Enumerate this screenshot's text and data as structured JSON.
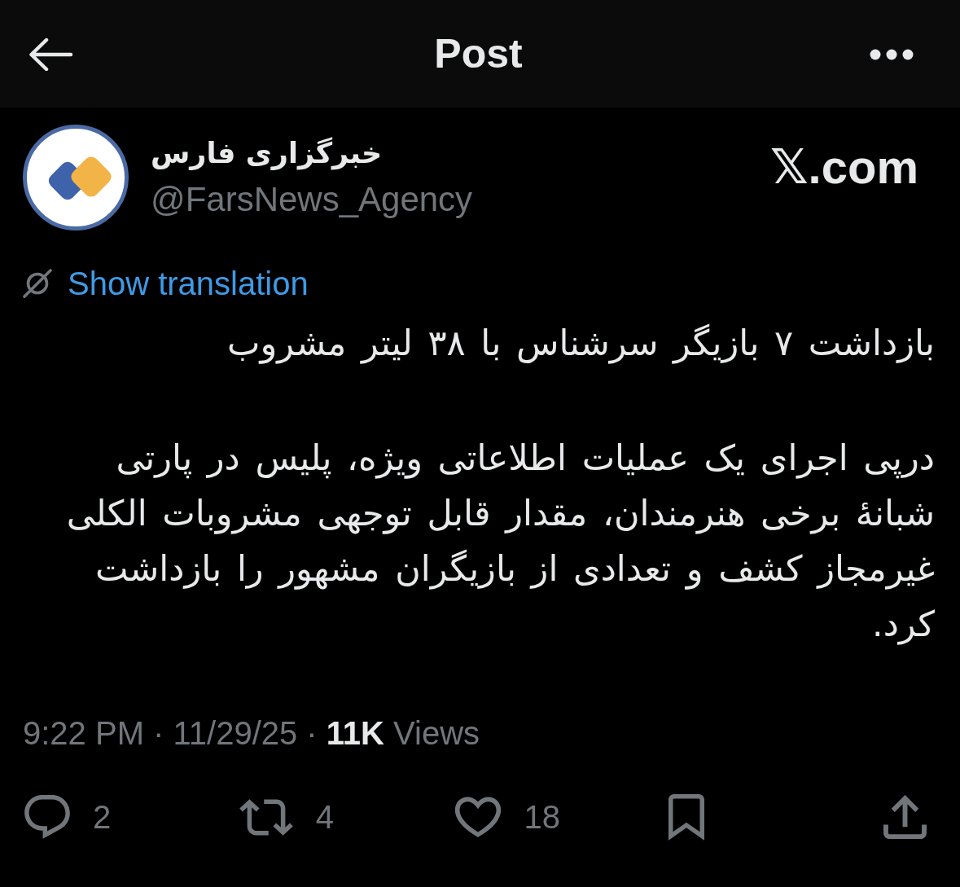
{
  "header": {
    "title": "Post"
  },
  "author": {
    "name": "خبرگزاری فارس",
    "handle": "@FarsNews_Agency"
  },
  "source_label": "𝕏.com",
  "translation": {
    "label": "Show translation"
  },
  "post": {
    "paragraphs": [
      "بازداشت ۷ بازیگر سرشناس با ۳۸ لیتر مشروب",
      "درپی اجرای یک عملیات اطلاعاتی ویژه، پلیس در پارتی شبانهٔ برخی هنرمندان، مقدار قابل توجهی مشروبات الکلی غیرمجاز کشف و تعدادی از بازیگران مشهور را بازداشت کرد."
    ],
    "meta": "9:22 PM · 11/29/25 · **11K** Views"
  },
  "action_bar": {
    "reply_count": "2",
    "repost_count": "4",
    "like_count": "18"
  }
}
